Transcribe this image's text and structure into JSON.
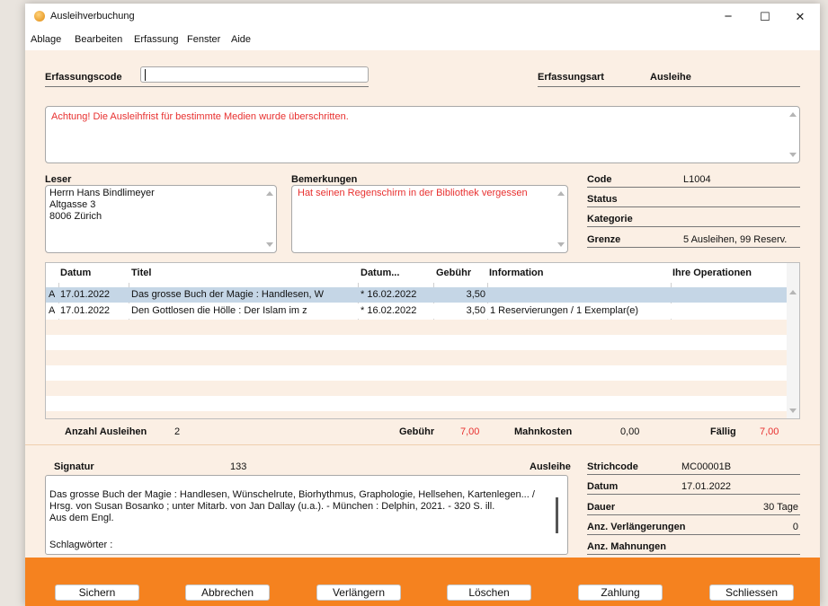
{
  "window": {
    "title": "Ausleihverbuchung",
    "minimize": "−",
    "maximize": "☐",
    "close": "✕"
  },
  "menu": [
    "Ablage",
    "Bearbeiten",
    "Erfassung",
    "Fenster",
    "Aide"
  ],
  "capture": {
    "code_label": "Erfassungscode",
    "code_value": "",
    "type_label": "Erfassungsart",
    "type_value": "Ausleihe"
  },
  "message": "Achtung! Die Ausleihfrist für bestimmte Medien wurde überschritten.",
  "reader": {
    "label": "Leser",
    "lines": [
      "Herrn Hans Bindlimeyer",
      "Altgasse 3",
      "8006 Zürich"
    ]
  },
  "remarks": {
    "label": "Bemerkungen",
    "text": "Hat seinen Regenschirm in der Bibliothek vergessen"
  },
  "info": {
    "code_label": "Code",
    "code_value": "L1004",
    "status_label": "Status",
    "status_value": "",
    "category_label": "Kategorie",
    "category_value": "",
    "limit_label": "Grenze",
    "limit_value": "5 Ausleihen, 99 Reserv."
  },
  "grid": {
    "headers": [
      "Datum",
      "Titel",
      "Datum...",
      "Gebühr",
      "Information",
      "Ihre Operationen"
    ],
    "rows": [
      {
        "flag": "A",
        "date": "17.01.2022",
        "title": "Das grosse Buch der Magie : Handlesen, W",
        "due": "* 16.02.2022",
        "fee": "3,50",
        "info": "",
        "ops": ""
      },
      {
        "flag": "A",
        "date": "17.01.2022",
        "title": "Den Gottlosen die Hölle : Der Islam im z",
        "due": "* 16.02.2022",
        "fee": "3,50",
        "info": "1 Reservierungen / 1 Exemplar(e)",
        "ops": ""
      }
    ]
  },
  "summary": {
    "loans_label": "Anzahl Ausleihen",
    "loans_value": "2",
    "fee_label": "Gebühr",
    "fee_value": "7,00",
    "dunning_label": "Mahnkosten",
    "dunning_value": "0,00",
    "due_label": "Fällig",
    "due_value": "7,00"
  },
  "detail": {
    "signature_label": "Signatur",
    "signature_value": "133",
    "loan_type": "Ausleihe",
    "description_lines": [
      "Das grosse Buch der Magie : Handlesen, Wünschelrute, Biorhythmus, Graphologie, Hellsehen, Kartenlegen... /",
      "Hrsg. von Susan Bosanko ; unter Mitarb. von Jan Dallay (u.a.). - München : Delphin, 2021. - 320 S. ill.",
      "Aus dem Engl.",
      "",
      "Schlagwörter :"
    ],
    "barcode_label": "Strichcode",
    "barcode_value": "MC00001B",
    "date_label": "Datum",
    "date_value": "17.01.2022",
    "duration_label": "Dauer",
    "duration_value": "30 Tage",
    "renewals_label": "Anz. Verlängerungen",
    "renewals_value": "0",
    "reminders_label": "Anz. Mahnungen",
    "reminders_value": ""
  },
  "buttons": [
    "Sichern",
    "Abbrechen",
    "Verlängern",
    "Löschen",
    "Zahlung",
    "Schliessen"
  ],
  "colors": {
    "accent": "#f5821f",
    "warning": "#e8302f",
    "selected_row": "#c5d6e6",
    "background": "#fbefe4"
  }
}
